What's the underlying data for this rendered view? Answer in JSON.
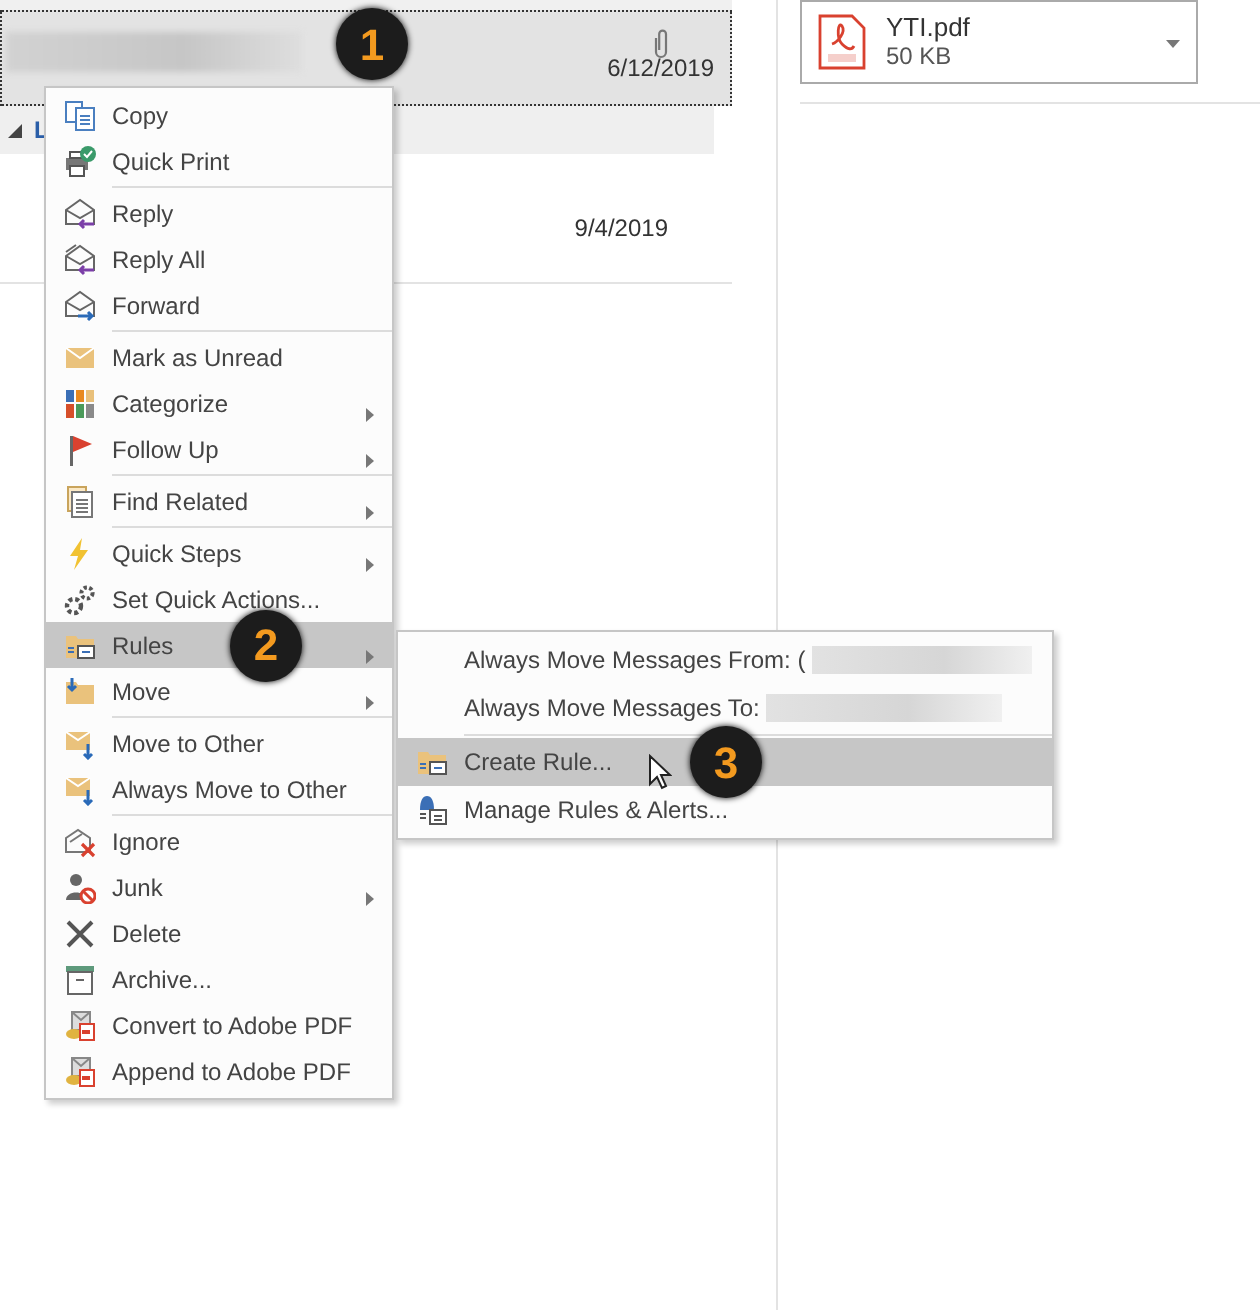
{
  "message_list": [
    {
      "kind": "message",
      "redacted": true,
      "attachment": true,
      "date": "6/12/2019",
      "selected": true,
      "callout": "1"
    },
    {
      "kind": "group",
      "label": "L",
      "expanded": true
    },
    {
      "kind": "message",
      "attachment": false,
      "date": "9/4/2019",
      "selected": false
    }
  ],
  "context_menu": {
    "groups": [
      [
        {
          "label": "Copy",
          "submenu": false,
          "selected": false
        },
        {
          "label": "Quick Print",
          "submenu": false,
          "selected": false
        }
      ],
      [
        {
          "label": "Reply",
          "submenu": false,
          "selected": false
        },
        {
          "label": "Reply All",
          "submenu": false,
          "selected": false
        },
        {
          "label": "Forward",
          "submenu": false,
          "selected": false
        }
      ],
      [
        {
          "label": "Mark as Unread",
          "submenu": false,
          "selected": false
        },
        {
          "label": "Categorize",
          "submenu": true,
          "selected": false
        },
        {
          "label": "Follow Up",
          "submenu": true,
          "selected": false
        }
      ],
      [
        {
          "label": "Find Related",
          "submenu": true,
          "selected": false
        }
      ],
      [
        {
          "label": "Quick Steps",
          "submenu": true,
          "selected": false
        },
        {
          "label": "Set Quick Actions...",
          "submenu": false,
          "selected": false
        },
        {
          "label": "Rules",
          "submenu": true,
          "selected": true,
          "callout": "2"
        },
        {
          "label": "Move",
          "submenu": true,
          "selected": false
        }
      ],
      [
        {
          "label": "Move to Other",
          "submenu": false,
          "selected": false
        },
        {
          "label": "Always Move to Other",
          "submenu": false,
          "selected": false
        }
      ],
      [
        {
          "label": "Ignore",
          "submenu": false,
          "selected": false
        },
        {
          "label": "Junk",
          "submenu": true,
          "selected": false
        },
        {
          "label": "Delete",
          "submenu": false,
          "selected": false
        },
        {
          "label": "Archive...",
          "submenu": false,
          "selected": false
        },
        {
          "label": "Convert to Adobe PDF",
          "submenu": false,
          "selected": false
        },
        {
          "label": "Append to Adobe PDF",
          "submenu": false,
          "selected": false
        }
      ]
    ]
  },
  "rules_submenu": {
    "groups": [
      [
        {
          "label": "Always Move Messages From: (",
          "redacted": true,
          "selected": false
        },
        {
          "label": "Always Move Messages To:",
          "redacted": true,
          "selected": false
        }
      ],
      [
        {
          "label": "Create Rule...",
          "selected": true,
          "callout": "3",
          "cursor": true
        },
        {
          "label": "Manage Rules & Alerts...",
          "selected": false
        }
      ]
    ]
  },
  "attachment": {
    "name": "YTI.pdf",
    "size": "50 KB",
    "kind": "pdf"
  }
}
